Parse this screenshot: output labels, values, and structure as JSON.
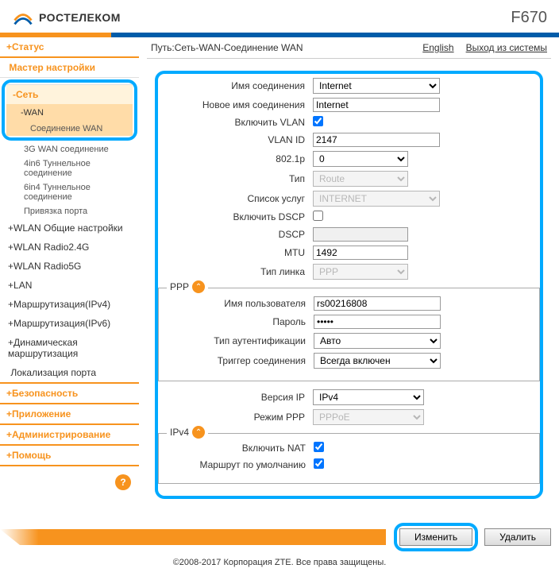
{
  "header": {
    "brand": "РОСТЕЛЕКОМ",
    "model": "F670"
  },
  "pathbar": {
    "path": "Путь:Сеть-WAN-Соединение WAN",
    "english": "English",
    "logout": "Выход из системы"
  },
  "sidebar": {
    "status": "Статус",
    "wizard": "Мастер настройки",
    "network": "Сеть",
    "wan": "WAN",
    "wan_items": [
      "Соединение WAN",
      "3G WAN соединение",
      "4in6 Туннельное соединение",
      "6in4 Туннельное соединение",
      "Привязка порта"
    ],
    "wlan_common": "WLAN Общие настройки",
    "wlan24": "WLAN Radio2.4G",
    "wlan5": "WLAN Radio5G",
    "lan": "LAN",
    "routing4": "Маршрутизация(IPv4)",
    "routing6": "Маршрутизация(IPv6)",
    "dynrouting": "Динамическая маршрутизация",
    "portloc": "Локализация порта",
    "security": "Безопасность",
    "app": "Приложение",
    "admin": "Администрирование",
    "help": "Помощь"
  },
  "form": {
    "conn_name_label": "Имя соединения",
    "conn_name": "Internet",
    "new_name_label": "Новое имя соединения",
    "new_name": "Internet",
    "vlan_enable_label": "Включить VLAN",
    "vlan_id_label": "VLAN ID",
    "vlan_id": "2147",
    "p8021_label": "802.1p",
    "p8021": "0",
    "type_label": "Тип",
    "type": "Route",
    "services_label": "Список услуг",
    "services": "INTERNET",
    "dscp_enable_label": "Включить DSCP",
    "dscp_label": "DSCP",
    "dscp": "",
    "mtu_label": "MTU",
    "mtu": "1492",
    "link_type_label": "Тип линка",
    "link_type": "PPP",
    "ppp_legend": "PPP",
    "ppp_user_label": "Имя пользователя",
    "ppp_user": "rs00216808",
    "ppp_pass_label": "Пароль",
    "ppp_pass": "•••••",
    "auth_label": "Тип аутентификации",
    "auth": "Авто",
    "trigger_label": "Триггер соединения",
    "trigger": "Всегда включен",
    "ipver_label": "Версия IP",
    "ipver": "IPv4",
    "pppmode_label": "Режим PPP",
    "pppmode": "PPPoE",
    "ipv4_legend": "IPv4",
    "nat_label": "Включить NAT",
    "defroute_label": "Маршрут по умолчанию"
  },
  "buttons": {
    "apply": "Изменить",
    "delete": "Удалить"
  },
  "footer": "©2008-2017 Корпорация ZTE. Все права защищены."
}
